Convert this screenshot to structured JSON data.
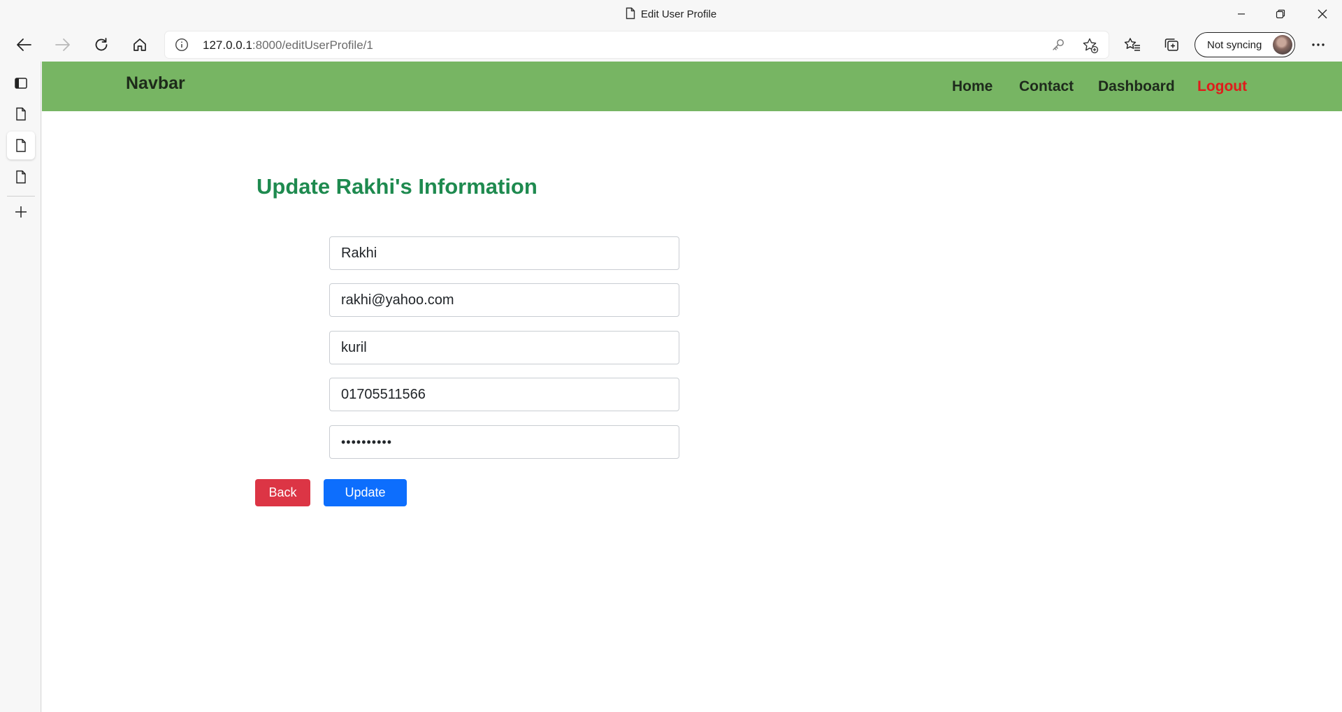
{
  "window": {
    "title": "Edit User Profile"
  },
  "toolbar": {
    "url_host": "127.0.0.1",
    "url_path": ":8000/editUserProfile/1",
    "sync_label": "Not syncing"
  },
  "icons": {
    "back": "arrow-left-icon",
    "forward": "arrow-right-icon",
    "reload": "reload-icon",
    "home": "home-icon",
    "info": "info-icon",
    "key": "key-icon",
    "add_favorite": "star-plus-icon",
    "favorites": "favorites-icon",
    "collections": "collections-icon",
    "more": "more-icon"
  },
  "navbar": {
    "brand": "Navbar",
    "links": [
      {
        "label": "Home"
      },
      {
        "label": "Contact"
      },
      {
        "label": "Dashboard"
      },
      {
        "label": "Logout"
      }
    ],
    "bg_color": "#77b563",
    "logout_color": "#e01b1b"
  },
  "form": {
    "heading": "Update Rakhi's Information",
    "name": "Rakhi",
    "email": "rakhi@yahoo.com",
    "address": "kuril",
    "phone": "01705511566",
    "password_masked": "••••••••••",
    "back_label": "Back",
    "update_label": "Update",
    "back_color": "#dc3545",
    "update_color": "#0d6efd",
    "heading_color": "#1e8a4f"
  }
}
